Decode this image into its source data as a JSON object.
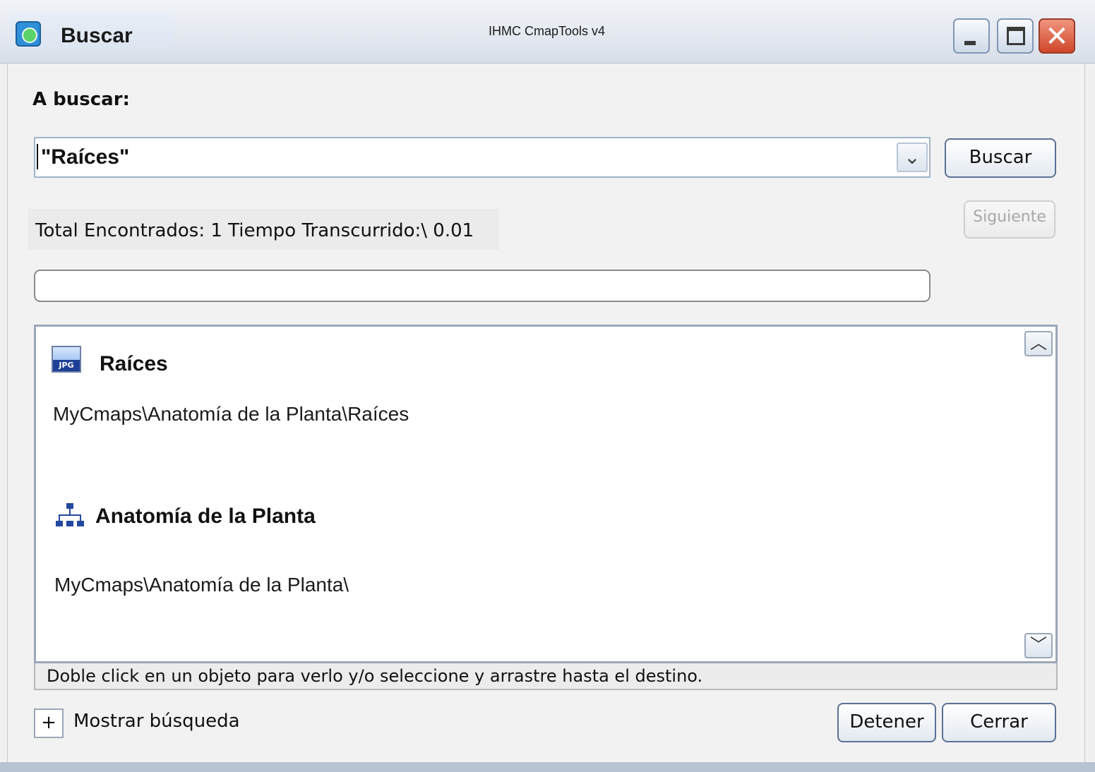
{
  "window": {
    "tab_title": "Buscar",
    "app_title": "IHMC CmapTools v4"
  },
  "search": {
    "label": "A buscar:",
    "value": "\"Raíces\"",
    "dropdown_icon": "chevron-down-icon",
    "button_label": "Buscar"
  },
  "status": {
    "text": "Total Encontrados:  1  Tiempo Transcurrido:\\ 0.01",
    "next_label": "Siguiente",
    "progress_fraction": 0
  },
  "results": [
    {
      "title": "Raíces",
      "path": "MyCmaps\\Anatomía de la Planta\\Raíces",
      "icon": "jpg-file-icon"
    },
    {
      "title": "Anatomía de la Planta",
      "path": "MyCmaps\\Anatomía de la Planta\\",
      "icon": "concept-map-icon"
    }
  ],
  "hint": "Doble click en un objeto para verlo y/o seleccione y arrastre hasta el destino.",
  "footer": {
    "expand_symbol": "+",
    "expand_label": "Mostrar búsqueda",
    "stop_label": "Detener",
    "close_label": "Cerrar"
  },
  "colors": {
    "titlebar": "#e3e8f0",
    "accent_border": "#5b7194",
    "close_button": "#d0462a"
  }
}
